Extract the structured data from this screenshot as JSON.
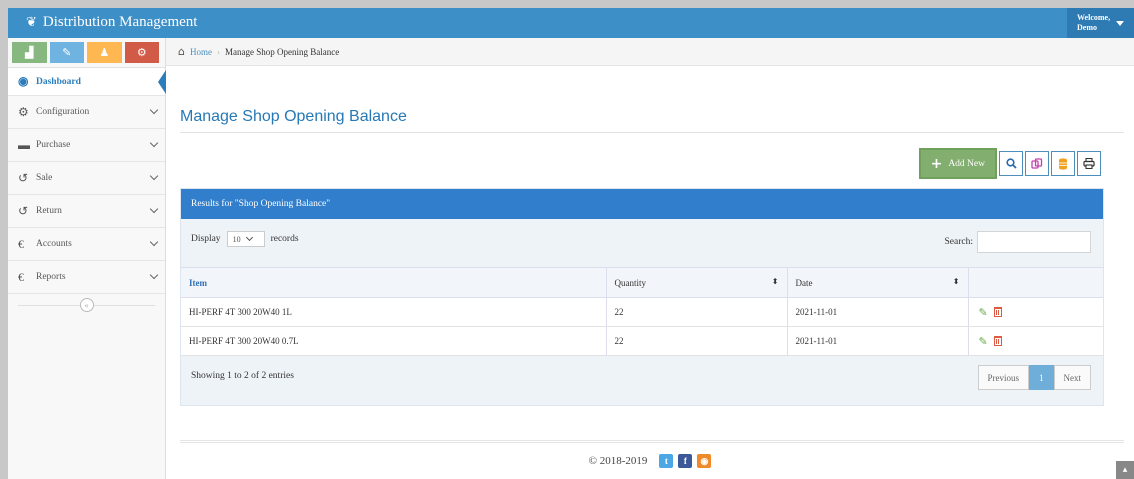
{
  "app": {
    "title": "Distribution Management"
  },
  "user": {
    "line1": "Welcome,",
    "line2": "Demo"
  },
  "quick_buttons": [
    {
      "icon": "chart-icon",
      "glyph": "▟"
    },
    {
      "icon": "pencil-icon",
      "glyph": "✎"
    },
    {
      "icon": "users-icon",
      "glyph": "♟"
    },
    {
      "icon": "cogs-icon",
      "glyph": "⚙"
    }
  ],
  "sidebar": {
    "items": [
      {
        "label": "Dashboard",
        "icon": "dashboard-icon",
        "glyph": "◉"
      },
      {
        "label": "Configuration",
        "icon": "cogs-icon",
        "glyph": "⚙"
      },
      {
        "label": "Purchase",
        "icon": "cart-icon",
        "glyph": "▬"
      },
      {
        "label": "Sale",
        "icon": "undo-icon",
        "glyph": "↺"
      },
      {
        "label": "Return",
        "icon": "undo-icon",
        "glyph": "↺"
      },
      {
        "label": "Accounts",
        "icon": "euro-icon",
        "glyph": "€"
      },
      {
        "label": "Reports",
        "icon": "euro-icon",
        "glyph": "€"
      }
    ],
    "collapse_glyph": "«"
  },
  "breadcrumb": {
    "home": "Home",
    "sep": "›",
    "current": "Manage Shop Opening Balance"
  },
  "page": {
    "title": "Manage Shop Opening Balance"
  },
  "toolbar": {
    "add_label": "Add New"
  },
  "results": {
    "header": "Results for \"Shop Opening Balance\"",
    "display_label": "Display",
    "display_value": "10",
    "records_label": "records",
    "search_label": "Search:"
  },
  "table": {
    "columns": [
      "Item",
      "Quantity",
      "Date",
      ""
    ],
    "rows": [
      {
        "item": "HI-PERF 4T 300 20W40 1L",
        "quantity": "22",
        "date": "2021-11-01"
      },
      {
        "item": "HI-PERF 4T 300 20W40 0.7L",
        "quantity": "22",
        "date": "2021-11-01"
      }
    ]
  },
  "pagination": {
    "info": "Showing 1 to 2 of 2 entries",
    "previous": "Previous",
    "current": "1",
    "next": "Next"
  },
  "footer": {
    "copyright": "© 2018-2019"
  },
  "colors": {
    "topbar": "#3d8fc8",
    "accent": "#307ecc",
    "add_button": "#82af6f"
  }
}
